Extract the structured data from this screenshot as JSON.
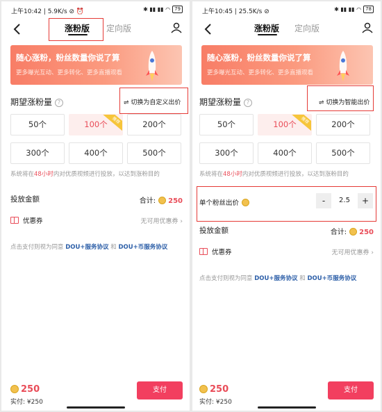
{
  "left": {
    "status": {
      "time": "上午10:42",
      "speed": "5.9K/s",
      "battery": "79"
    },
    "tabs": [
      "涨粉版",
      "定向版"
    ],
    "active_tab": 0,
    "banner": {
      "title": "随心涨粉，粉丝数量你说了算",
      "subtitle": "更多曝光互动、更多转化、更多直播观看"
    },
    "section_title": "期望涨粉量",
    "help_icon": "?",
    "switch_label": "切换为自定义出价",
    "options": [
      "50个",
      "100个",
      "200个",
      "300个",
      "400个",
      "500个"
    ],
    "selected_option": 1,
    "badge": "推荐",
    "note": {
      "prefix": "系统将在",
      "highlight": "48小时",
      "suffix": "内对优质视频进行投放，以达到涨粉目的"
    },
    "amount_label": "投放金额",
    "total_label": "合计:",
    "total_value": "250",
    "coupon_label": "优惠券",
    "coupon_value": "无可用优惠券",
    "agreement": {
      "prefix": "点击支付则视为同意",
      "link1": "DOU+服务协议",
      "and": "和",
      "link2": "DOU+币服务协议"
    },
    "bottom": {
      "coins": "250",
      "paid": "实付: ¥250",
      "pay_button": "支付"
    }
  },
  "right": {
    "status": {
      "time": "上午10:45",
      "speed": "25.5K/s",
      "battery": "78"
    },
    "tabs": [
      "涨粉版",
      "定向版"
    ],
    "active_tab": 0,
    "banner": {
      "title": "随心涨粉，粉丝数量你说了算",
      "subtitle": "更多曝光互动、更多转化、更多直播观看"
    },
    "section_title": "期望涨粉量",
    "help_icon": "?",
    "switch_label": "切换为智能出价",
    "options": [
      "50个",
      "100个",
      "200个",
      "300个",
      "400个",
      "500个"
    ],
    "selected_option": 1,
    "badge": "推荐",
    "note": {
      "prefix": "系统将在",
      "highlight": "48小时",
      "suffix": "内对优质视频进行投放，以达到涨粉目的"
    },
    "unit_price_label": "单个粉丝出价",
    "stepper": {
      "minus": "-",
      "value": "2.5",
      "plus": "+"
    },
    "amount_label": "投放金额",
    "total_label": "合计:",
    "total_value": "250",
    "coupon_label": "优惠券",
    "coupon_value": "无可用优惠券",
    "agreement": {
      "prefix": "点击支付则视为同意",
      "link1": "DOU+服务协议",
      "and": "和",
      "link2": "DOU+币服务协议"
    },
    "bottom": {
      "coins": "250",
      "paid": "实付: ¥250",
      "pay_button": "支付"
    }
  },
  "icons": [
    "back-arrow-icon",
    "user-icon",
    "rocket-icon",
    "help-icon",
    "swap-icon",
    "coin-icon",
    "coupon-icon",
    "chevron-right-icon"
  ],
  "colors": {
    "accent": "#f23f5f",
    "price": "#e94c58",
    "link": "#2d5fa8",
    "highlight_box": "#e53935",
    "badge": "#f6c53a",
    "banner": "#f87d66"
  }
}
